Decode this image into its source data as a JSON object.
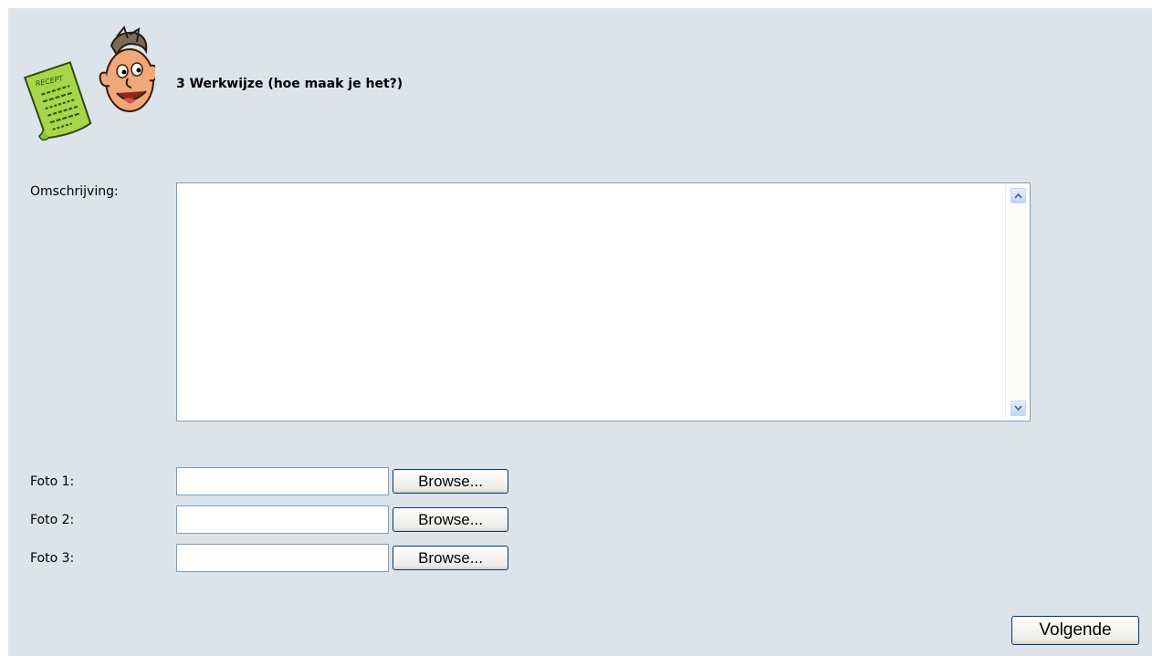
{
  "header": {
    "title": "3 Werkwijze (hoe maak je het?)",
    "logo_icon": "recipe-card-chef-mascot-icon",
    "logo_text": "RECEPT"
  },
  "description": {
    "label": "Omschrijving:",
    "value": ""
  },
  "photos": [
    {
      "label": "Foto 1:",
      "value": "",
      "button_label": "Browse..."
    },
    {
      "label": "Foto 2:",
      "value": "",
      "button_label": "Browse..."
    },
    {
      "label": "Foto 3:",
      "value": "",
      "button_label": "Browse..."
    }
  ],
  "footer": {
    "next_label": "Volgende"
  },
  "colors": {
    "panel_background": "#dce3e9",
    "input_border": "#7f9db9",
    "button_border": "#003c74"
  }
}
